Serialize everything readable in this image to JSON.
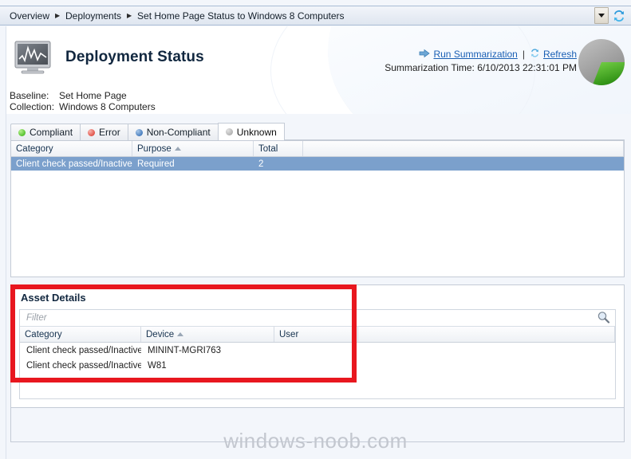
{
  "breadcrumb": {
    "items": [
      "Overview",
      "Deployments",
      "Set Home Page Status to Windows 8 Computers"
    ],
    "separator": "▶",
    "dropdown_icon": "chevron-down-icon",
    "refresh_icon": "refresh-icon"
  },
  "header": {
    "title": "Deployment Status",
    "icon": "monitor-chart-icon",
    "baseline_label": "Baseline:",
    "baseline_value": "Set Home Page",
    "collection_label": "Collection:",
    "collection_value": "Windows 8 Computers",
    "run_summarization": "Run Summarization",
    "run_summarization_icon": "arrow-right-icon",
    "separator": "|",
    "refresh": "Refresh",
    "refresh_icon": "refresh-icon",
    "summarization_time_label": "Summarization Time:",
    "summarization_time_value": "6/10/2013 22:31:01 PM"
  },
  "pie": {
    "name": "compliance-pie-chart",
    "slices": [
      {
        "label": "Unknown",
        "color": "#9a9a9a",
        "percent": 72
      },
      {
        "label": "Compliant",
        "color": "#3fa92b",
        "percent": 28
      }
    ]
  },
  "tabs": [
    {
      "label": "Compliant",
      "dot": "#57c230",
      "active": false
    },
    {
      "label": "Error",
      "dot": "#e2564c",
      "active": false
    },
    {
      "label": "Non-Compliant",
      "dot": "#4a7fbf",
      "active": false
    },
    {
      "label": "Unknown",
      "dot": "#b4b4b4",
      "active": true
    }
  ],
  "top_grid": {
    "columns": [
      {
        "label": "Category",
        "sort": ""
      },
      {
        "label": "Purpose",
        "sort": "asc"
      },
      {
        "label": "Total",
        "sort": ""
      },
      {
        "label": "",
        "sort": ""
      }
    ],
    "rows": [
      {
        "category": "Client check passed/Inactive",
        "purpose": "Required",
        "total": "2",
        "selected": true
      }
    ]
  },
  "asset_details": {
    "title": "Asset Details",
    "filter_placeholder": "Filter",
    "filter_value": "",
    "search_icon": "search-icon",
    "columns": [
      {
        "label": "Category",
        "sort": ""
      },
      {
        "label": "Device",
        "sort": "asc"
      },
      {
        "label": "User",
        "sort": ""
      },
      {
        "label": "",
        "sort": ""
      }
    ],
    "rows": [
      {
        "category": "Client check passed/Inactive",
        "device": "MININT-MGRI763",
        "user": ""
      },
      {
        "category": "Client check passed/Inactive",
        "device": "W81",
        "user": ""
      }
    ]
  },
  "annotation": {
    "name": "red-highlight-box",
    "color": "#e8171f"
  },
  "watermark": "windows-noob.com"
}
